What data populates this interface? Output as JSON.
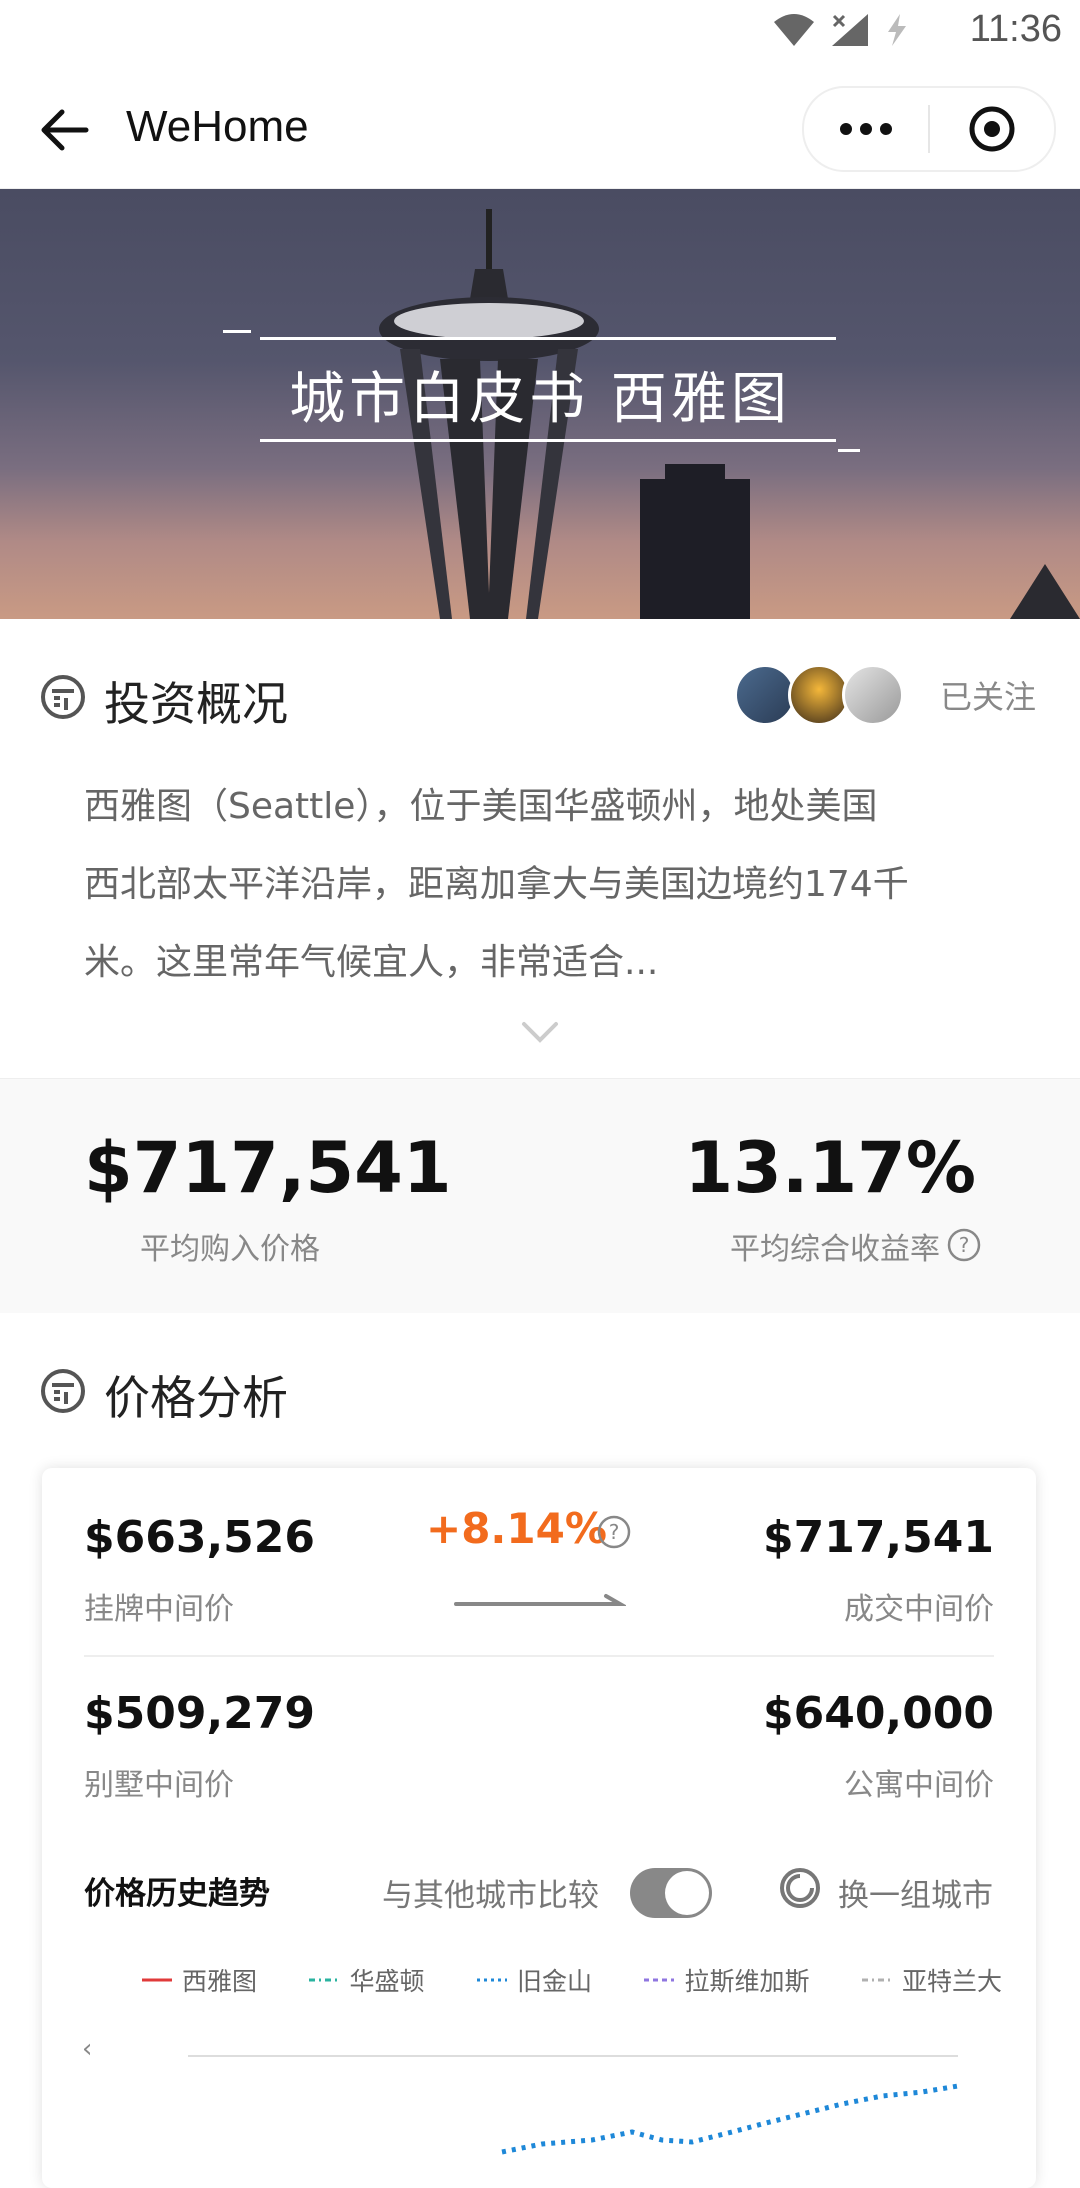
{
  "status": {
    "time": "11:36"
  },
  "nav": {
    "title": "WeHome"
  },
  "banner": {
    "title": "城市白皮书 西雅图"
  },
  "overview": {
    "title": "投资概况",
    "follow_label": "已关注",
    "desc_lines": [
      "西雅图（Seattle），位于美国华盛顿州，地处美国",
      "西北部太平洋沿岸，距离加拿大与美国边境约174千",
      "米。这里常年气候宜人，非常适合..."
    ]
  },
  "stats": {
    "avg_price": "$717,541",
    "avg_price_label": "平均购入价格",
    "avg_return": "13.17%",
    "avg_return_label": "平均综合收益率"
  },
  "price_analysis": {
    "title": "价格分析",
    "listing_price": "$663,526",
    "listing_label": "挂牌中间价",
    "change_pct": "+8.14%",
    "deal_price": "$717,541",
    "deal_label": "成交中间价",
    "villa_price": "$509,279",
    "villa_label": "别墅中间价",
    "apt_price": "$640,000",
    "apt_label": "公寓中间价",
    "trend_title": "价格历史趋势",
    "compare_label": "与其他城市比较",
    "compare_enabled": true,
    "swap_label": "换一组城市",
    "axis_arrow": "‹",
    "legend": [
      {
        "name": "西雅图",
        "color": "#e03a3a",
        "style": "solid"
      },
      {
        "name": "华盛顿",
        "color": "#2ab3a0",
        "style": "dash-dot"
      },
      {
        "name": "旧金山",
        "color": "#1e88d8",
        "style": "dotted"
      },
      {
        "name": "拉斯维加斯",
        "color": "#8f76e0",
        "style": "dash"
      },
      {
        "name": "亚特兰大",
        "color": "#b0b0b0",
        "style": "dash-dot"
      }
    ]
  }
}
